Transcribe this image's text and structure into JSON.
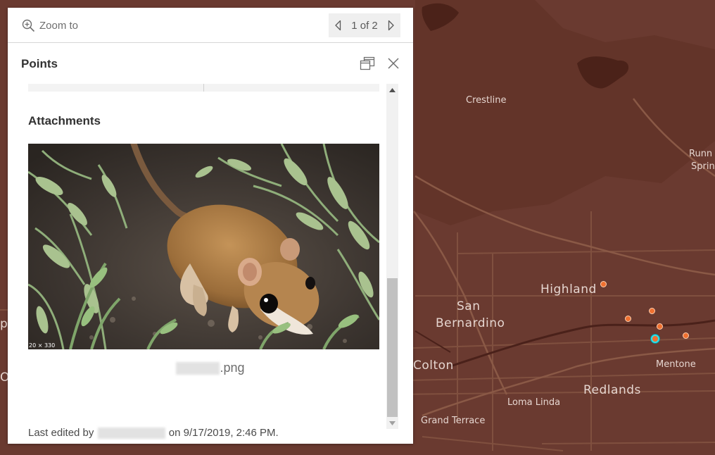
{
  "map": {
    "background": "#6a3a30",
    "labels": {
      "crestline": "Crestline",
      "running_springs_1": "Runn",
      "running_springs_2": "Sprin",
      "highland": "Highland",
      "san": "San",
      "bernardino": "Bernardino",
      "colton": "Colton",
      "mentone": "Mentone",
      "redlands": "Redlands",
      "loma_linda": "Loma Linda",
      "grand_terrace": "Grand Terrace",
      "edge_p": "p",
      "edge_o": "O"
    },
    "marker_color": "#f07030",
    "selected_marker_color": "#30e0e8"
  },
  "popup": {
    "toolbar": {
      "zoom_to_label": "Zoom to",
      "zoom_icon": "zoom-in-icon",
      "pager_text": "1 of 2",
      "prev_icon": "chevron-left-icon",
      "next_icon": "chevron-right-icon"
    },
    "title": "Points",
    "dock_icon": "dock-icon",
    "close_icon": "close-icon",
    "attachments": {
      "heading": "Attachments",
      "image_size_text": "20 × 330",
      "file_name_suffix": ".png"
    },
    "last_edited": {
      "prefix": "Last edited by",
      "suffix": "on 9/17/2019, 2:46 PM."
    }
  }
}
